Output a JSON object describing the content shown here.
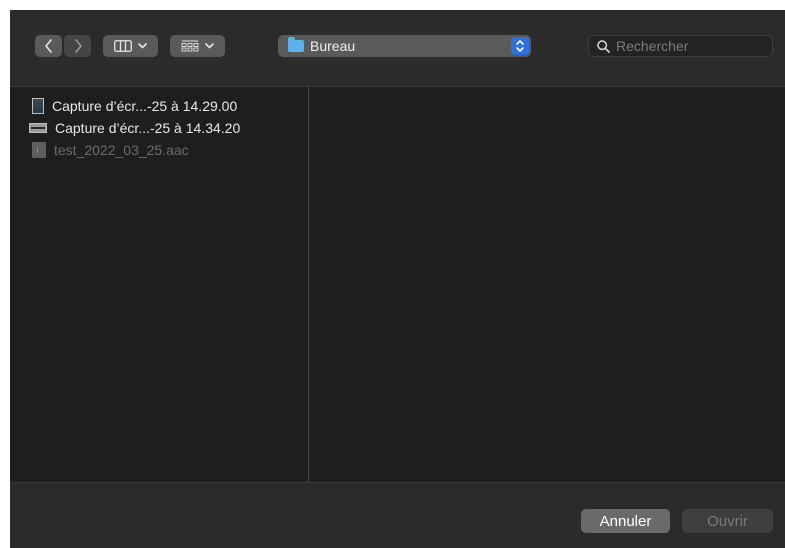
{
  "toolbar": {
    "back_icon": "chevron-left-icon",
    "forward_icon": "chevron-right-icon",
    "view_icon": "column-view-icon",
    "group_icon": "grid-group-icon",
    "location": {
      "label": "Bureau",
      "icon": "folder-icon",
      "accent": "#2c6fe0"
    },
    "search": {
      "placeholder": "Rechercher",
      "value": ""
    }
  },
  "files": [
    {
      "name": "Capture d’écr...-25 à 14.29.00",
      "icon": "screenshot-thumbnail-icon",
      "enabled": true
    },
    {
      "name": "Capture d’écr...-25 à 14.34.20",
      "icon": "screenshot-thumbnail-icon",
      "enabled": true
    },
    {
      "name": "test_2022_03_25.aac",
      "icon": "audio-file-icon",
      "enabled": false
    }
  ],
  "buttons": {
    "cancel": "Annuler",
    "open": "Ouvrir"
  }
}
